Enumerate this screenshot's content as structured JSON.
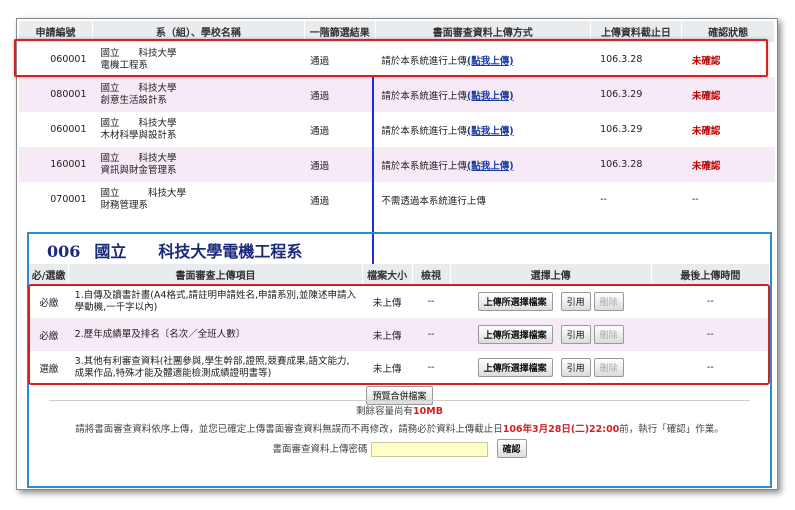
{
  "table1": {
    "headers": [
      "申請編號",
      "系（組）、學校名稱",
      "一階篩選結果",
      "書面審查資料上傳方式",
      "上傳資料截止日",
      "確認狀態"
    ],
    "rows": [
      {
        "id": "060001",
        "school": "國立　　科技大學",
        "dept": "電機工程系",
        "result": "通過",
        "method_prefix": "請於本系統進行上傳",
        "method_link": "(點我上傳)",
        "deadline": "106.3.28",
        "status": "未確認"
      },
      {
        "id": "080001",
        "school": "國立　　科技大學",
        "dept": "創意生活設計系",
        "result": "通過",
        "method_prefix": "請於本系統進行上傳",
        "method_link": "(點我上傳)",
        "deadline": "106.3.29",
        "status": "未確認"
      },
      {
        "id": "060001",
        "school": "國立　　科技大學",
        "dept": "木材科學與設計系",
        "result": "通過",
        "method_prefix": "請於本系統進行上傳",
        "method_link": "(點我上傳)",
        "deadline": "106.3.29",
        "status": "未確認"
      },
      {
        "id": "160001",
        "school": "國立　　科技大學",
        "dept": "資訊與財金管理系",
        "result": "通過",
        "method_prefix": "請於本系統進行上傳",
        "method_link": "(點我上傳)",
        "deadline": "106.3.28",
        "status": "未確認"
      },
      {
        "id": "070001",
        "school": "國立　　　科技大學",
        "dept": "財務管理系",
        "result": "通過",
        "method_prefix": "不需透過本系統進行上傳",
        "method_link": "",
        "deadline": "--",
        "status": "--"
      }
    ]
  },
  "panel": {
    "code": "006",
    "title": "國立　　科技大學電機工程系",
    "headers": [
      "必/選繳",
      "書面審查上傳項目",
      "檔案大小",
      "檢視",
      "選擇上傳",
      "最後上傳時間"
    ],
    "items": [
      {
        "req": "必繳",
        "text": "1.自傳及讀書計畫(A4格式,請註明申請姓名,申請系別,並陳述申請入學動機,一千字以內)",
        "size": "未上傳",
        "view": "--",
        "upload": "上傳所選擇檔案",
        "cite": "引用",
        "del": "刪除",
        "last": "--"
      },
      {
        "req": "必繳",
        "text": "2.歷年成績單及排名〔名次／全班人數〕",
        "size": "未上傳",
        "view": "--",
        "upload": "上傳所選擇檔案",
        "cite": "引用",
        "del": "刪除",
        "last": "--"
      },
      {
        "req": "選繳",
        "text": "3.其他有利審查資料(社團參與,學生幹部,證照,競賽成果,語文能力,成果作品,特殊才能及體適能檢測成績證明書等)",
        "size": "未上傳",
        "view": "--",
        "upload": "上傳所選擇檔案",
        "cite": "引用",
        "del": "刪除",
        "last": "--"
      }
    ],
    "preview_btn": "預覽合併檔案",
    "remain_prefix": "剩餘容量尚有",
    "remain_value": "10MB",
    "notice_prefix": "請將書面審查資料依序上傳，並您已確定上傳書面審查資料無誤而不再修改，請務必於資料上傳截止日",
    "notice_date": "106年3月28日(二)22:00",
    "notice_suffix": "前，執行「確認」作業。",
    "pw_label": "書面審查資料上傳密碼",
    "confirm_btn": "確認"
  },
  "colors": {
    "accent_red": "#d32020",
    "link_blue": "#1a3ca8",
    "panel_border": "#2a8ad8",
    "arrow": "#1e2fe0"
  }
}
